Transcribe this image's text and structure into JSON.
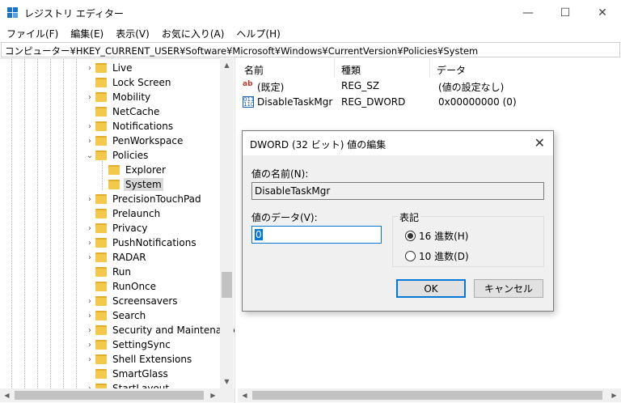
{
  "window": {
    "title": "レジストリ エディター",
    "minimize": "—",
    "maximize": "☐",
    "close": "✕"
  },
  "menu": [
    "ファイル(F)",
    "編集(E)",
    "表示(V)",
    "お気に入り(A)",
    "ヘルプ(H)"
  ],
  "address": "コンピューター¥HKEY_CURRENT_USER¥Software¥Microsoft¥Windows¥CurrentVersion¥Policies¥System",
  "tree": {
    "items": [
      {
        "label": "Live",
        "chevron": "›"
      },
      {
        "label": "Lock Screen",
        "chevron": ""
      },
      {
        "label": "Mobility",
        "chevron": "›"
      },
      {
        "label": "NetCache",
        "chevron": ""
      },
      {
        "label": "Notifications",
        "chevron": "›"
      },
      {
        "label": "PenWorkspace",
        "chevron": "›"
      },
      {
        "label": "Policies",
        "chevron": "⌄"
      },
      {
        "label": "Explorer",
        "chevron": ""
      },
      {
        "label": "System",
        "chevron": ""
      },
      {
        "label": "PrecisionTouchPad",
        "chevron": "›"
      },
      {
        "label": "Prelaunch",
        "chevron": ""
      },
      {
        "label": "Privacy",
        "chevron": "›"
      },
      {
        "label": "PushNotifications",
        "chevron": "›"
      },
      {
        "label": "RADAR",
        "chevron": "›"
      },
      {
        "label": "Run",
        "chevron": ""
      },
      {
        "label": "RunOnce",
        "chevron": ""
      },
      {
        "label": "Screensavers",
        "chevron": "›"
      },
      {
        "label": "Search",
        "chevron": "›"
      },
      {
        "label": "Security and Maintenance",
        "chevron": "›"
      },
      {
        "label": "SettingSync",
        "chevron": "›"
      },
      {
        "label": "Shell Extensions",
        "chevron": "›"
      },
      {
        "label": "SmartGlass",
        "chevron": ""
      },
      {
        "label": "StartLayout",
        "chevron": "›"
      }
    ]
  },
  "list": {
    "columns": [
      "名前",
      "種類",
      "データ"
    ],
    "rows": [
      {
        "name": "(既定)",
        "type": "REG_SZ",
        "data": "(値の設定なし)",
        "icon": "string-value-icon"
      },
      {
        "name": "DisableTaskMgr",
        "type": "REG_DWORD",
        "data": "0x00000000 (0)",
        "icon": "binary-value-icon"
      }
    ]
  },
  "dialog": {
    "title": "DWORD (32 ビット) 値の編集",
    "name_label": "値の名前(N):",
    "name_value": "DisableTaskMgr",
    "data_label": "値のデータ(V):",
    "data_value": "0",
    "base_label": "表記",
    "radio_hex": "16 進数(H)",
    "radio_dec": "10 進数(D)",
    "selected_base": "hex",
    "ok": "OK",
    "cancel": "キャンセル"
  }
}
